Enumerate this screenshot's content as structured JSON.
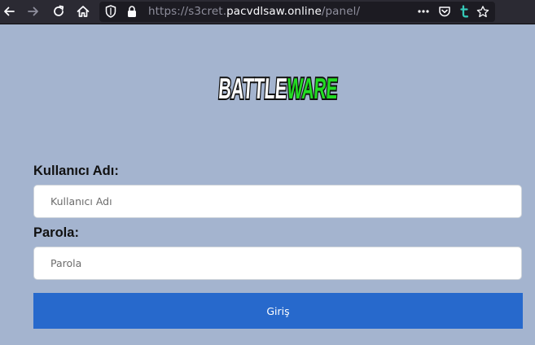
{
  "browser": {
    "url_prefix": "https://s3cret.",
    "url_host": "pacvdlsaw.online",
    "url_path": "/panel/",
    "icons": [
      "back-arrow-icon",
      "forward-arrow-icon",
      "reload-icon",
      "home-icon",
      "shield-icon",
      "lock-icon",
      "more-icon",
      "pocket-icon",
      "tumblr-icon",
      "star-icon"
    ]
  },
  "logo": {
    "part1": "BATTLE",
    "part2": "WARE",
    "colors": {
      "part1": "#ffffff",
      "part2": "#22dd22",
      "outline": "#111111"
    }
  },
  "form": {
    "username_label": "Kullanıcı Adı:",
    "username_placeholder": "Kullanıcı Adı",
    "username_value": "",
    "password_label": "Parola:",
    "password_placeholder": "Parola",
    "password_value": "",
    "submit_label": "Giriş"
  },
  "colors": {
    "page_background": "#a4b4cf",
    "toolbar": "#2b2a33",
    "button": "#2769cc"
  }
}
